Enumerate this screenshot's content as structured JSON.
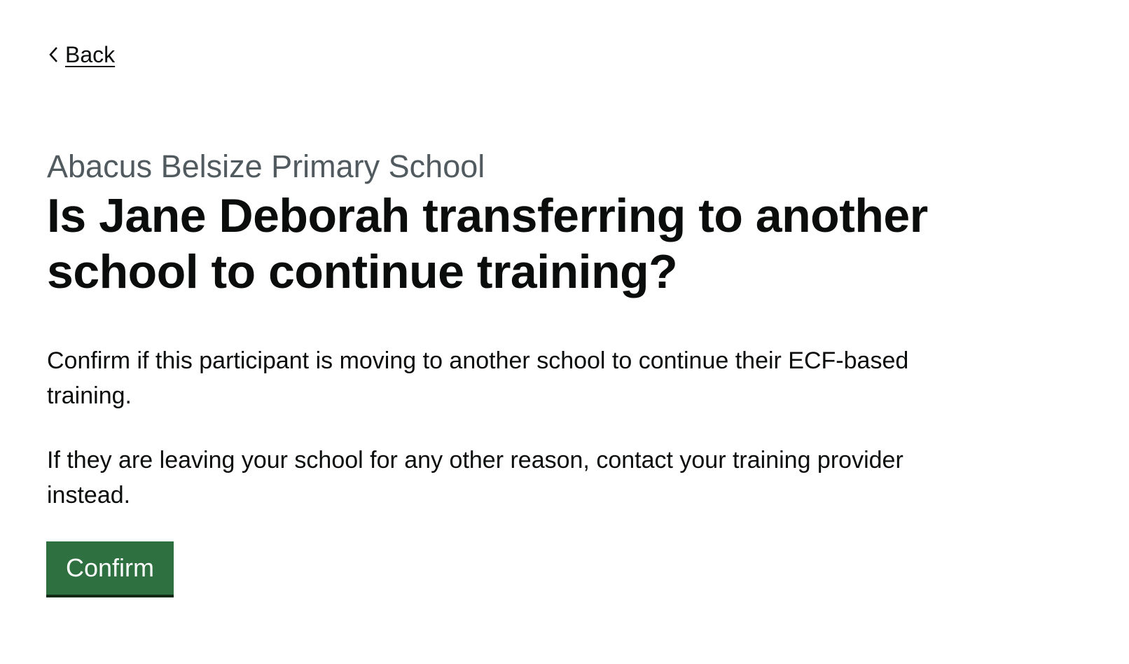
{
  "back_link": {
    "label": "Back",
    "icon": "chevron-left-icon"
  },
  "caption": "Abacus Belsize Primary School",
  "heading": "Is Jane Deborah transferring to another school to continue training?",
  "paragraphs": [
    "Confirm if this participant is moving to another school to continue their ECF-based training.",
    "If they are leaving your school for any other reason, contact your training provider instead."
  ],
  "confirm_button": {
    "label": "Confirm"
  },
  "colors": {
    "button_green": "#2e7040",
    "caption_grey": "#505a5f",
    "text": "#0b0c0c"
  }
}
